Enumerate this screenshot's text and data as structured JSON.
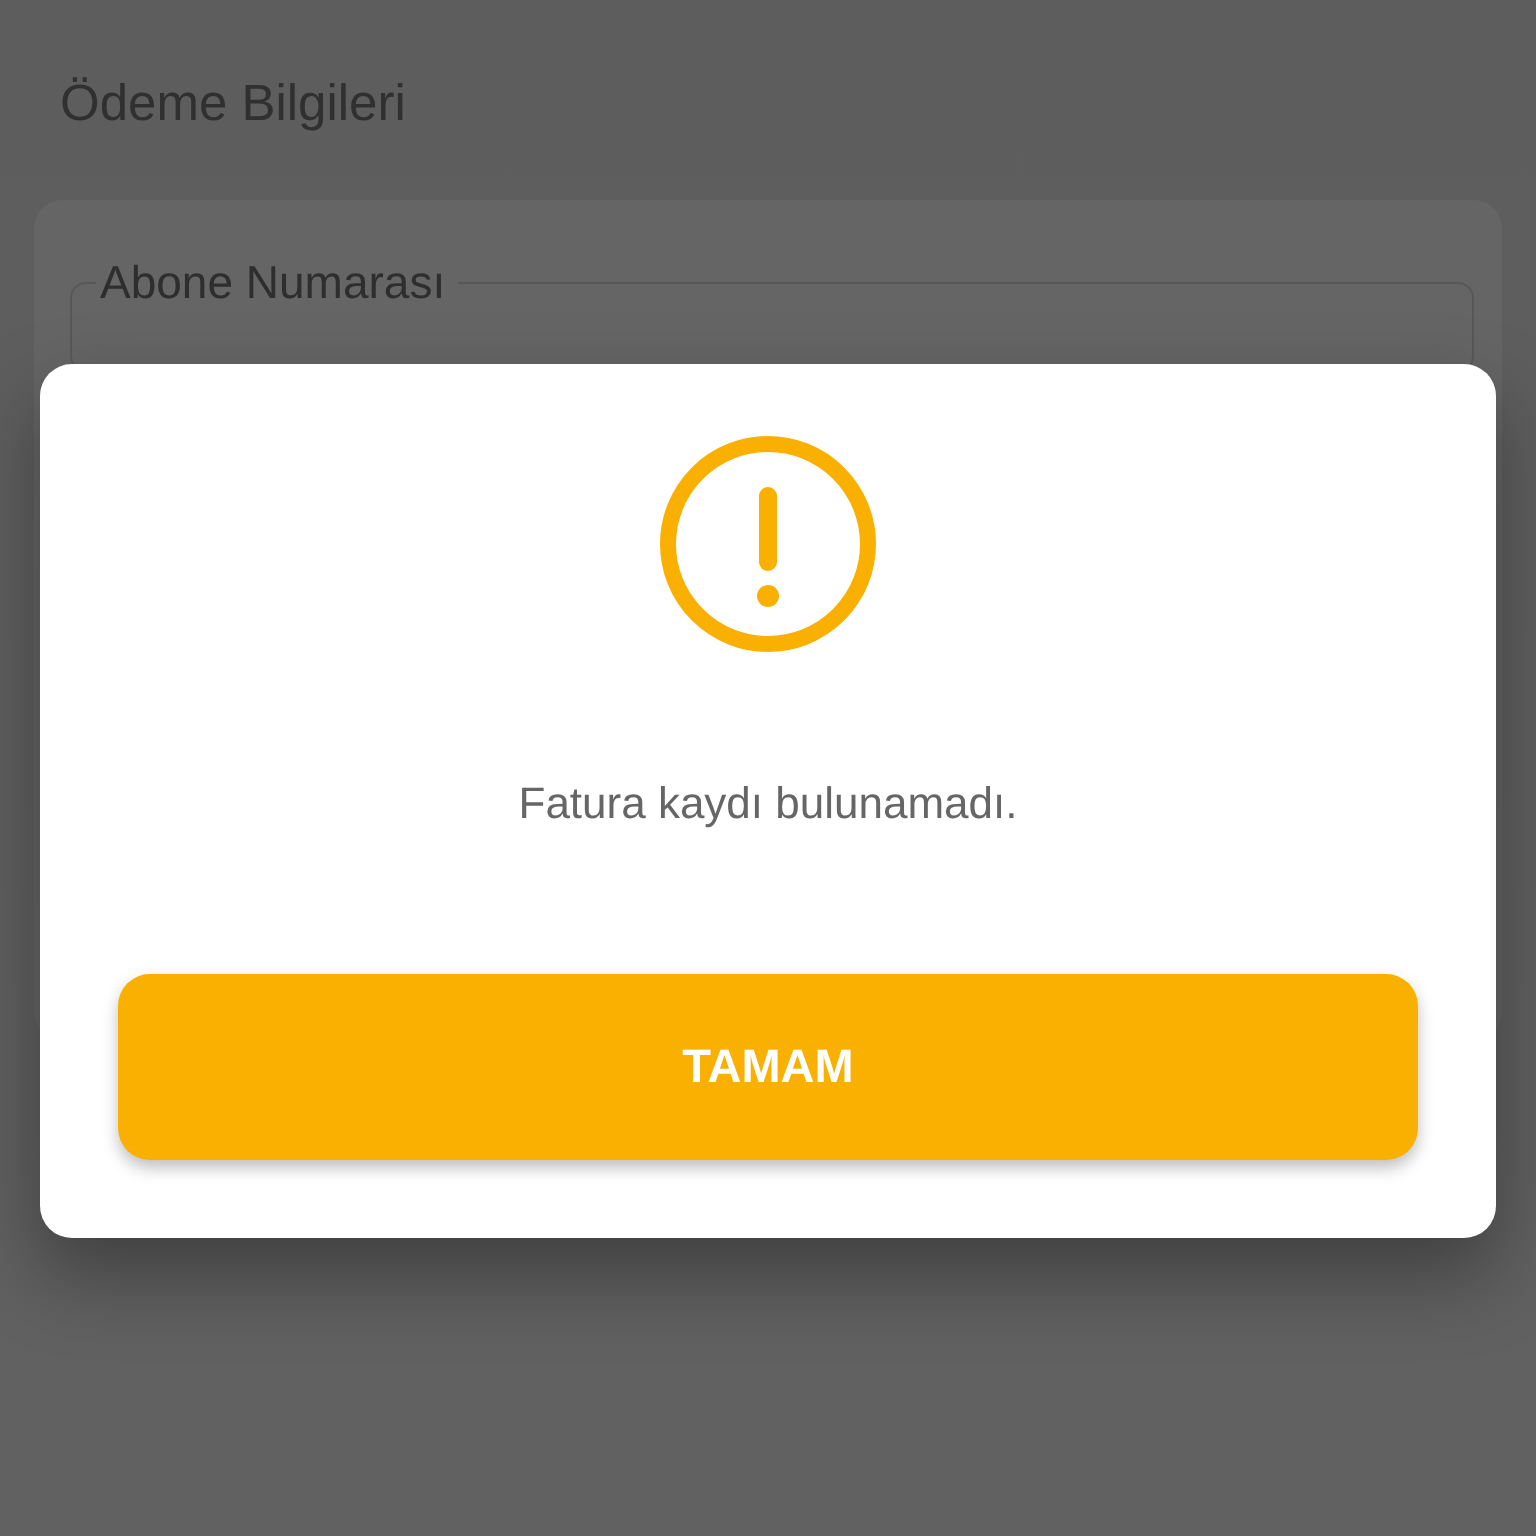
{
  "screen": {
    "title": "Ödeme Bilgileri",
    "field": {
      "label": "Abone Numarası"
    }
  },
  "dialog": {
    "message": "Fatura kaydı bulunamadı.",
    "button": "TAMAM"
  }
}
